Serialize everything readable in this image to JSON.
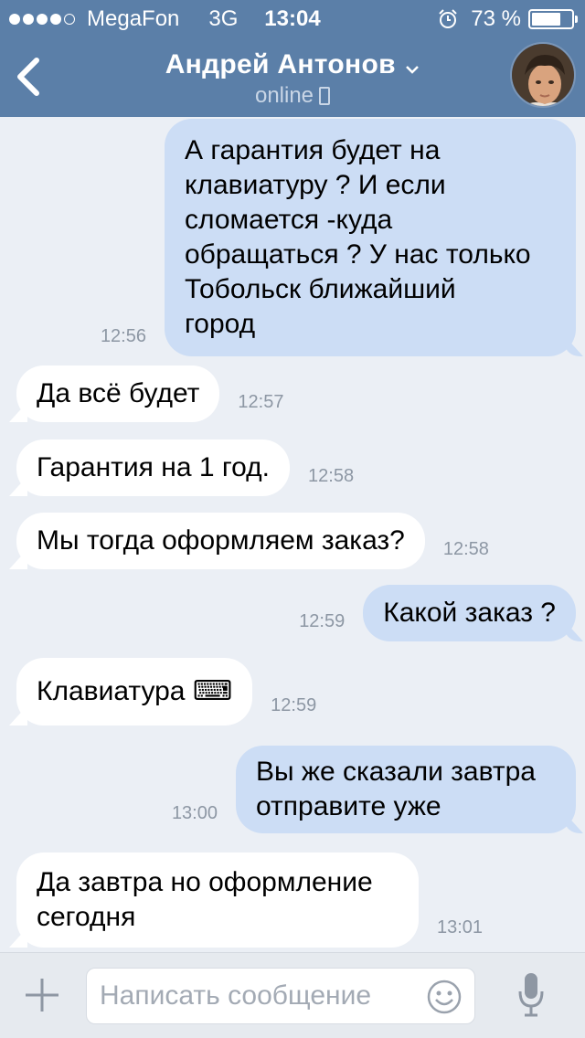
{
  "status_bar": {
    "carrier": "MegaFon",
    "network": "3G",
    "time": "13:04",
    "battery": "73 %",
    "battery_level": 0.73,
    "signal_bars": 4
  },
  "header": {
    "contact_name": "Андрей Антонов",
    "status": "online"
  },
  "messages": [
    {
      "dir": "out",
      "text": "А гарантия будет на\nклавиатуру ? И если\nсломается -куда\nобращаться ? У нас только\nТобольск ближайший\nгород",
      "time": "12:56"
    },
    {
      "dir": "in",
      "text": "Да всё будет",
      "time": "12:57"
    },
    {
      "dir": "in",
      "text": "Гарантия на 1 год.",
      "time": "12:58"
    },
    {
      "dir": "in",
      "text": "Мы тогда оформляем заказ?",
      "time": "12:58"
    },
    {
      "dir": "out",
      "text": "Какой заказ ?",
      "time": "12:59"
    },
    {
      "dir": "in",
      "text": "Клавиатура ⌨",
      "time": "12:59"
    },
    {
      "dir": "out",
      "text": "Вы же сказали завтра\nотправите уже",
      "time": "13:00"
    },
    {
      "dir": "in",
      "text": "Да завтра но оформление\nсегодня",
      "time": "13:01"
    }
  ],
  "input": {
    "placeholder": "Написать сообщение"
  },
  "colors": {
    "header_bg": "#5B7FA8",
    "chat_bg": "#EBEFF5",
    "outgoing_bubble": "#CCDDF5",
    "incoming_bubble": "#FFFFFF",
    "timestamp": "#8D97A4"
  },
  "icons": [
    "back-icon",
    "chevron-down-icon",
    "phone-icon",
    "alarm-icon",
    "battery-icon",
    "plus-icon",
    "smile-icon",
    "microphone-icon",
    "keyboard-emoji"
  ]
}
